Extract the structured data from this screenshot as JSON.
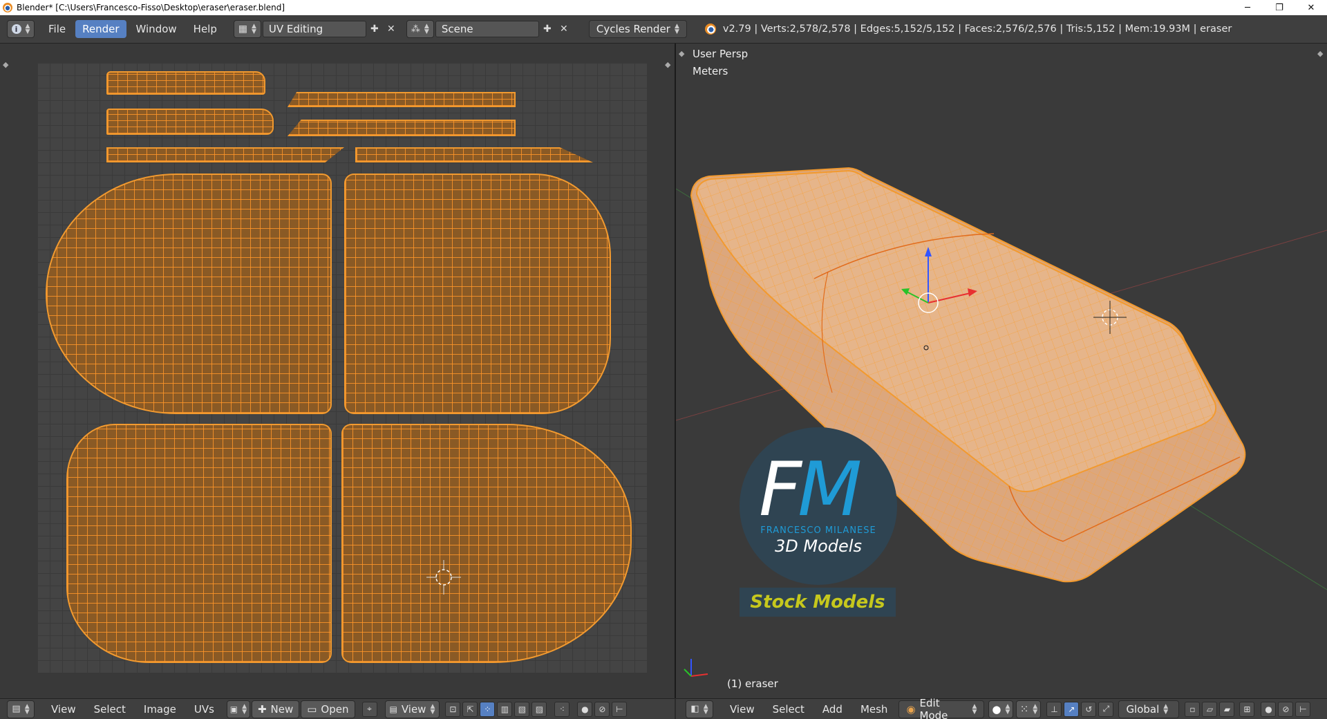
{
  "window": {
    "title": "Blender* [C:\\Users\\Francesco-Fisso\\Desktop\\eraser\\eraser.blend]",
    "minimize": "─",
    "restore": "❐",
    "close": "✕"
  },
  "info_header": {
    "menus": [
      "File",
      "Render",
      "Window",
      "Help"
    ],
    "active_menu": "Render",
    "screen_layout": "UV Editing",
    "scene": "Scene",
    "render_engine": "Cycles Render",
    "stats": "v2.79 | Verts:2,578/2,578 | Edges:5,152/5,152 | Faces:2,576/2,576 | Tris:5,152 | Mem:19.93M | eraser"
  },
  "viewport": {
    "view_label": "User Persp",
    "units_label": "Meters",
    "object_label": "(1) eraser"
  },
  "logo": {
    "letter_f": "F",
    "letter_m": "M",
    "subtitle": "FRANCESCO MILANESE",
    "tagline": "3D Models",
    "banner": "Stock Models"
  },
  "uv_footer": {
    "menus": [
      "View",
      "Select",
      "Image",
      "UVs"
    ],
    "new_label": "New",
    "open_label": "Open",
    "view_label": "View"
  },
  "viewport_footer": {
    "menus": [
      "View",
      "Select",
      "Add",
      "Mesh"
    ],
    "mode": "Edit Mode",
    "orientation": "Global"
  },
  "colors": {
    "accent": "#5680c2",
    "wire": "#f29a2f",
    "mesh": "#e8b98c",
    "logo_blue": "#1f9bd6",
    "logo_yellow": "#c6c81d"
  }
}
